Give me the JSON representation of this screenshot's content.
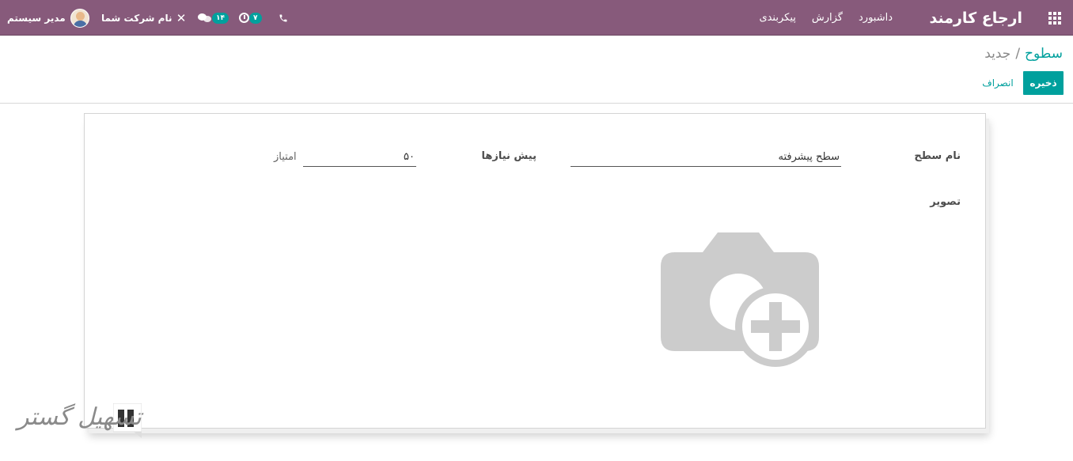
{
  "navbar": {
    "brand": "ارجاع کارمند",
    "menu": [
      "داشبورد",
      "گزارش",
      "پیکربندی"
    ],
    "user_name": "مدیر سیستم",
    "company_name": "نام شرکت شما",
    "chat_count": "۱۴",
    "activity_count": "۷",
    "bg_color": "#875a7b",
    "icons": [
      "apps-icon",
      "debug-icon",
      "chat-icon",
      "clock-icon",
      "phone-icon"
    ]
  },
  "breadcrumb": {
    "parent": "سطوح",
    "separator": "/",
    "current": "جدید"
  },
  "buttons": {
    "save": "ذخیره",
    "discard": "انصراف"
  },
  "form": {
    "level_name_label": "نام سطح",
    "level_name_value": "سطح پیشرفته",
    "prerequisites_label": "پیش نیازها",
    "points_value": "۵۰",
    "points_label": "امتیاز",
    "image_label": "تصویر"
  },
  "watermark": {
    "text": "تسهیل گستر"
  },
  "accent_color": "#00a09d"
}
